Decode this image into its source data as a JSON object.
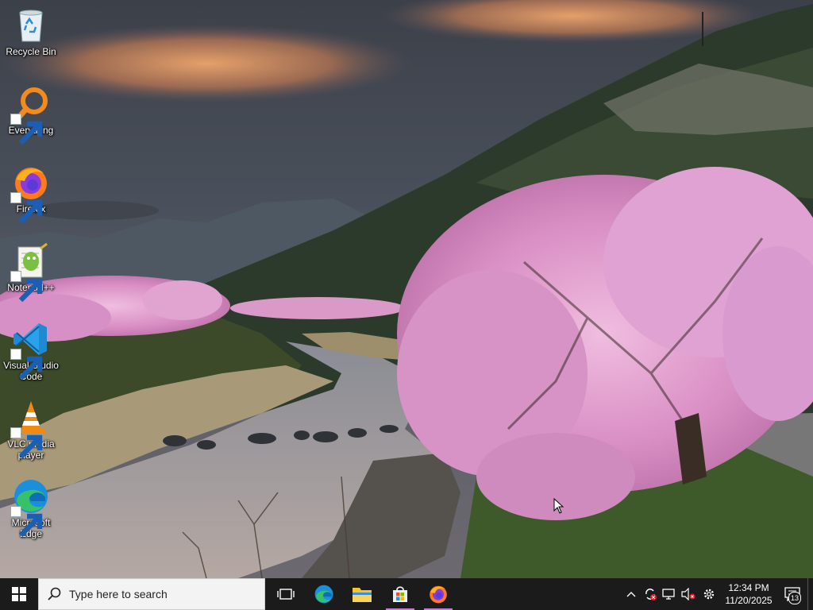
{
  "desktop": {
    "icons": [
      {
        "label": "Recycle Bin",
        "icon": "recycle-bin-icon",
        "shortcut": false
      },
      {
        "label": "Everything",
        "icon": "everything-search-icon",
        "shortcut": true
      },
      {
        "label": "Firefox",
        "icon": "firefox-icon",
        "shortcut": true
      },
      {
        "label": "Notepad++",
        "icon": "notepadpp-icon",
        "shortcut": true
      },
      {
        "label": "Visual Studio Code",
        "icon": "vscode-icon",
        "shortcut": true
      },
      {
        "label": "VLC media player",
        "icon": "vlc-icon",
        "shortcut": true
      },
      {
        "label": "Microsoft Edge",
        "icon": "edge-icon",
        "shortcut": true
      }
    ]
  },
  "taskbar": {
    "search": {
      "placeholder": "Type here to search"
    },
    "pinned": [
      {
        "name": "task-view",
        "icon": "task-view-icon"
      },
      {
        "name": "edge",
        "icon": "edge-icon"
      },
      {
        "name": "file-explorer",
        "icon": "folder-icon"
      },
      {
        "name": "microsoft-store",
        "icon": "store-icon",
        "running": true
      },
      {
        "name": "firefox",
        "icon": "firefox-icon",
        "running": true
      }
    ],
    "tray": {
      "time": "12:34 PM",
      "date": "11/20/2025",
      "notification_count": "13",
      "icons": [
        "chevron-up-icon",
        "sync-error-icon",
        "network-icon",
        "volume-muted-icon",
        "settings-gear-icon"
      ]
    }
  },
  "colors": {
    "taskbar_bg": "#1b1b1b",
    "running_indicator": "#c97bd8",
    "search_bg": "#f3f3f3"
  }
}
